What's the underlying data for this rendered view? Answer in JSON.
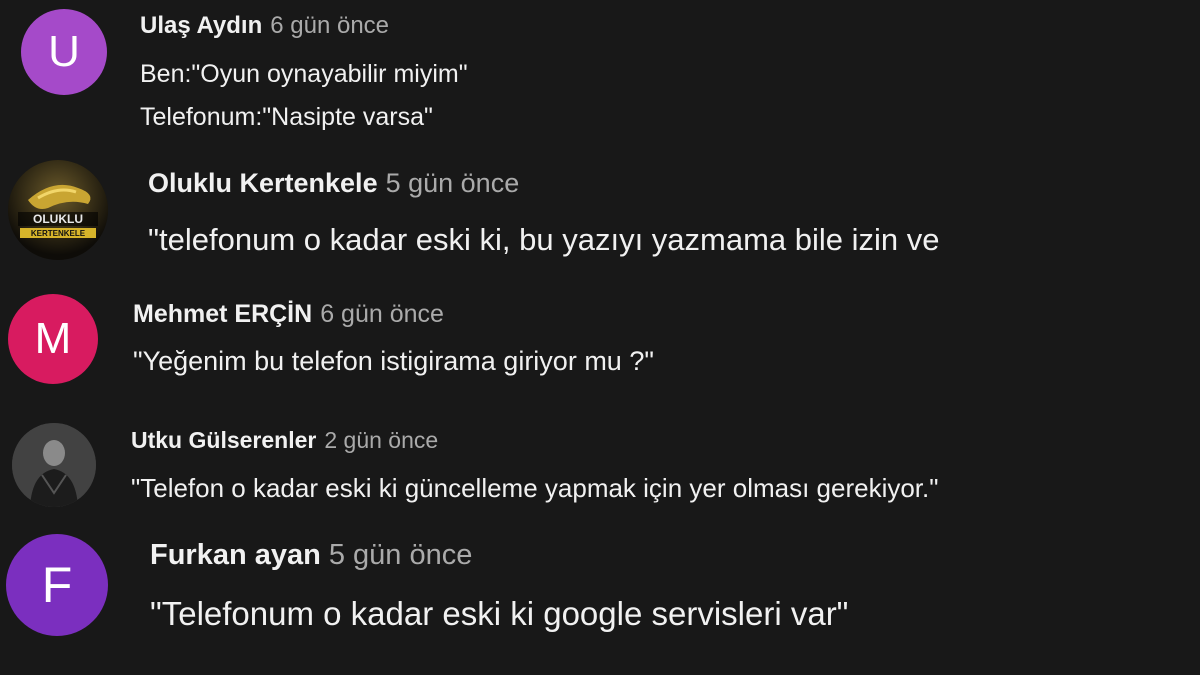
{
  "comments": [
    {
      "author": "Ulaş Aydın",
      "time": "6 gün önce",
      "avatar_letter": "U",
      "avatar_color": "#a54ac9",
      "lines": [
        "Ben:\"Oyun oynayabilir miyim\"",
        "Telefonum:\"Nasipte varsa\""
      ]
    },
    {
      "author": "Oluklu Kertenkele",
      "time": "5 gün önce",
      "avatar_image_text": "OLUKLU KERTENKELE",
      "lines": [
        "\"telefonum o kadar eski ki, bu yazıyı yazmama bile izin ve"
      ]
    },
    {
      "author": "Mehmet ERÇİN",
      "time": "6 gün önce",
      "avatar_letter": "M",
      "avatar_color": "#d81b60",
      "lines": [
        "\"Yeğenim bu telefon istigirama giriyor mu ?\""
      ]
    },
    {
      "author": "Utku Gülserenler",
      "time": "2 gün önce",
      "avatar_kind": "photo",
      "lines": [
        "\"Telefon o kadar eski ki güncelleme yapmak için yer olması gerekiyor.\""
      ]
    },
    {
      "author": "Furkan ayan",
      "time": "5 gün önce",
      "avatar_letter": "F",
      "avatar_color": "#7b2fbf",
      "lines": [
        "\"Telefonum o kadar eski ki google servisleri var\""
      ]
    }
  ]
}
